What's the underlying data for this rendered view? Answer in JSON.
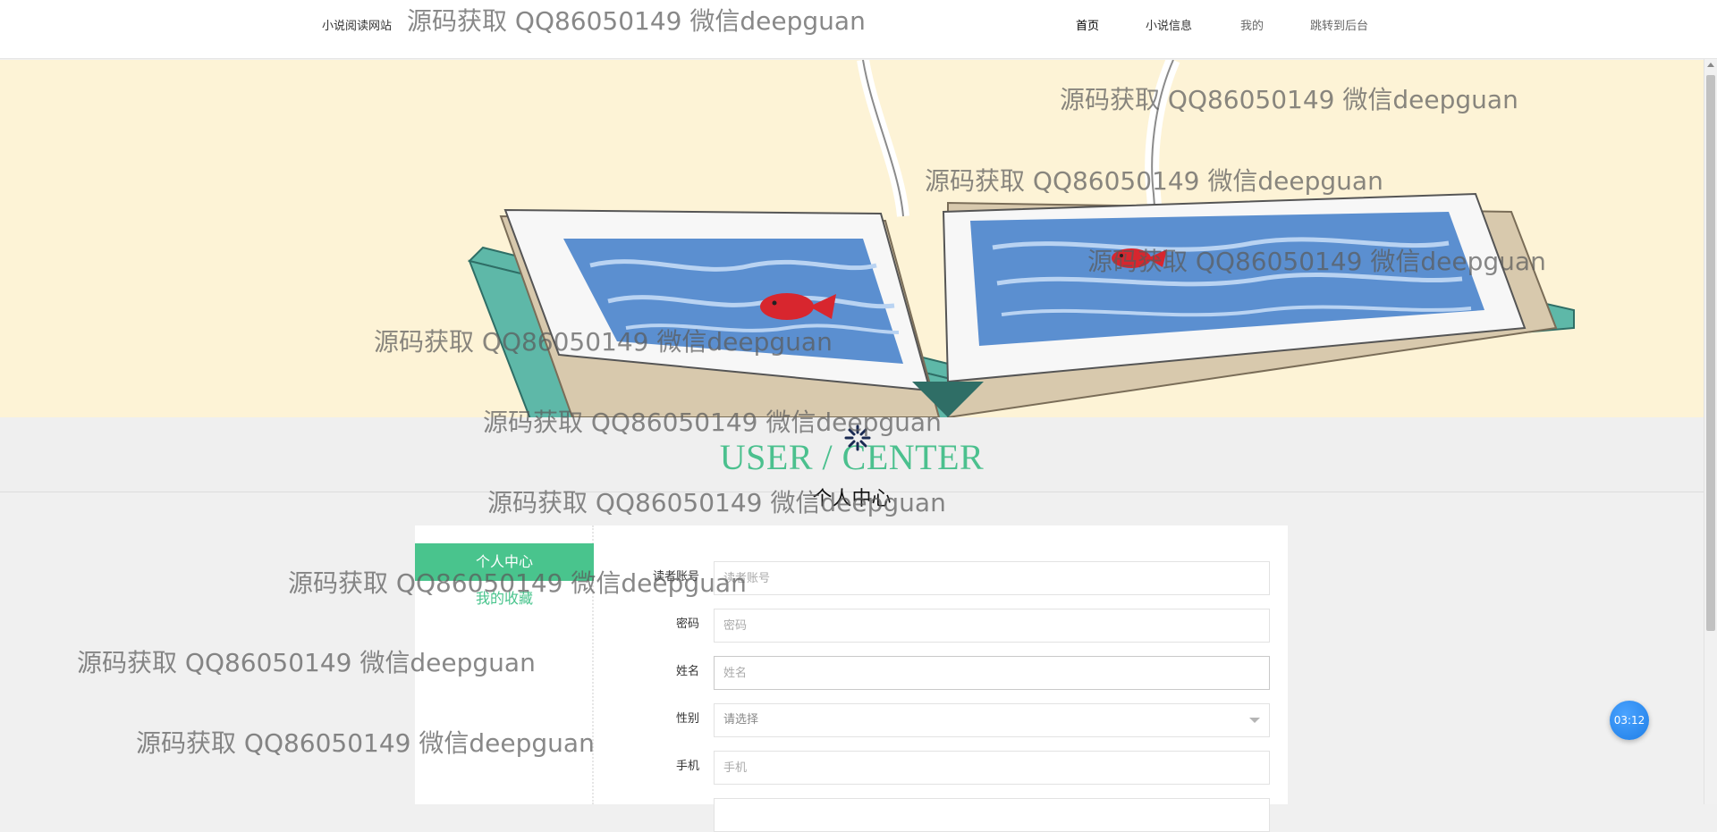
{
  "header": {
    "brand": "小说阅读网站",
    "nav": [
      {
        "label": "首页"
      },
      {
        "label": "小说信息"
      },
      {
        "label": "我的"
      },
      {
        "label": "跳转到后台"
      }
    ]
  },
  "section": {
    "title_en": "USER / CENTER",
    "title_zh": "个人中心"
  },
  "sidebar": {
    "items": [
      {
        "label": "个人中心"
      },
      {
        "label": "我的收藏"
      }
    ]
  },
  "form": {
    "fields": [
      {
        "label": "读者账号",
        "placeholder": "读者账号"
      },
      {
        "label": "密码",
        "placeholder": "密码"
      },
      {
        "label": "姓名",
        "placeholder": "姓名"
      },
      {
        "label": "性别",
        "placeholder": "请选择"
      },
      {
        "label": "手机",
        "placeholder": "手机"
      }
    ]
  },
  "timer": "03:12",
  "watermark": "源码获取 QQ86050149 微信deepguan",
  "colors": {
    "accent": "#49c48d",
    "banner_bg": "#fdf3d6",
    "timer": "#1f7ee6"
  }
}
